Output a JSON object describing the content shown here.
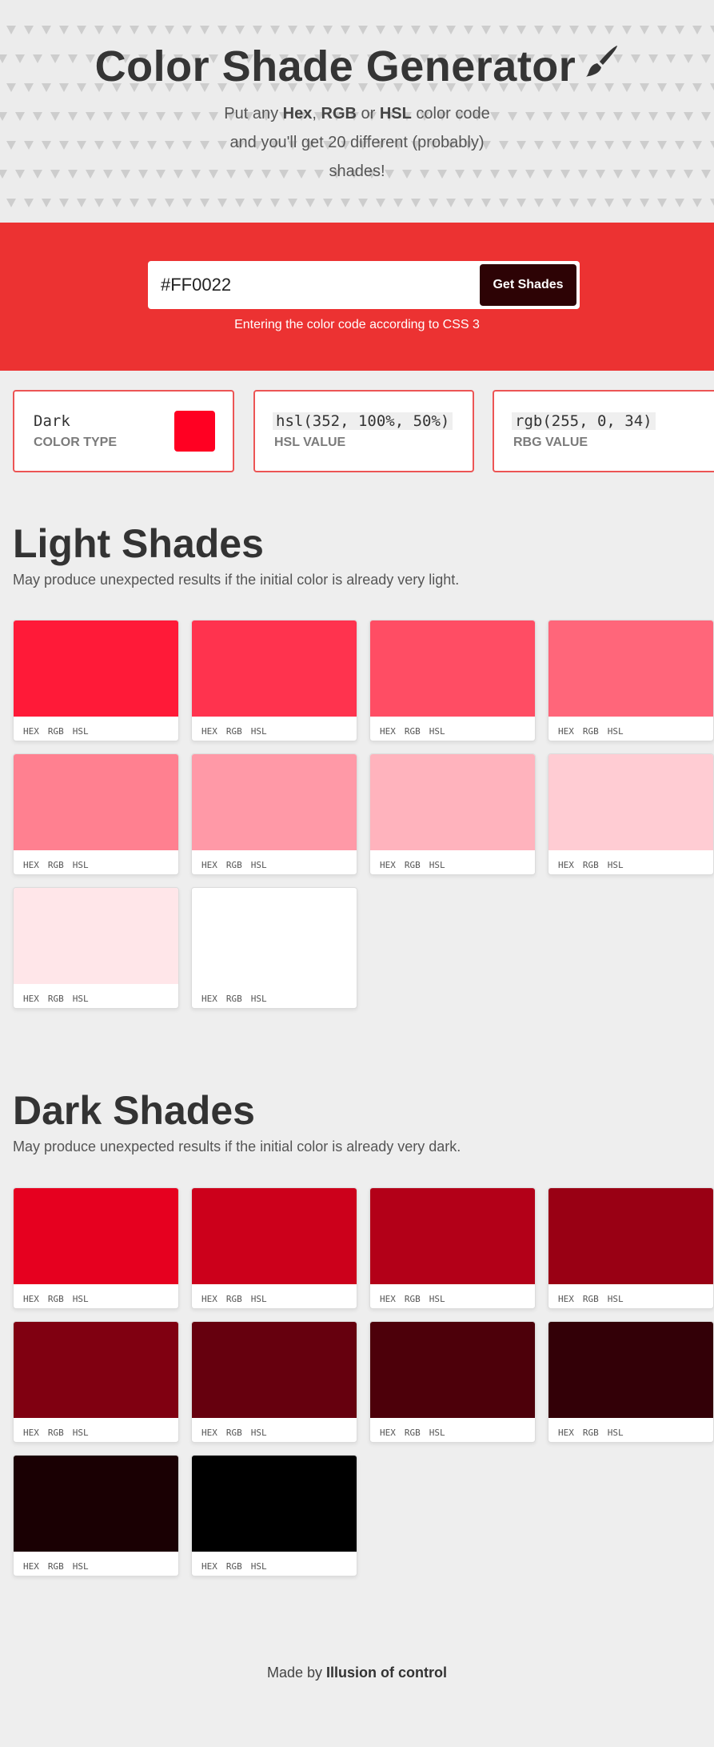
{
  "header": {
    "title": "Color Shade Generator",
    "brush_icon": "paintbrush-icon",
    "subtitle_prefix": "Put any ",
    "subtitle_hex": "Hex",
    "subtitle_sep1": ", ",
    "subtitle_rgb": "RGB",
    "subtitle_or": " or ",
    "subtitle_hsl": "HSL",
    "subtitle_rest": " color code and you'll get 20 different (probably) shades!"
  },
  "form": {
    "input_value": "#FF0022",
    "button_label": "Get Shades",
    "hint": "Entering the color code according to CSS 3"
  },
  "info": {
    "type_value": "Dark",
    "type_label": "COLOR TYPE",
    "swatch_color": "#FF0022",
    "hsl_value": "hsl(352, 100%, 50%)",
    "hsl_label": "HSL VALUE",
    "rgb_value": "rgb(255, 0, 34)",
    "rgb_label": "RBG VALUE"
  },
  "light": {
    "title": "Light Shades",
    "description": "May produce unexpected results if the initial color is already very light.",
    "shades": [
      "#FF1A38",
      "#FF334E",
      "#FF4D64",
      "#FF667A",
      "#FF8090",
      "#FF99A7",
      "#FFB3BD",
      "#FFCCD3",
      "#FFE6E9",
      "#FFFFFF"
    ]
  },
  "dark": {
    "title": "Dark Shades",
    "description": "May produce unexpected results if the initial color is already very dark.",
    "shades": [
      "#E6001F",
      "#CC001B",
      "#B30018",
      "#990014",
      "#800011",
      "#66000E",
      "#4D000A",
      "#330007",
      "#1A0003",
      "#000000"
    ]
  },
  "card_links": [
    "HEX",
    "RGB",
    "HSL"
  ],
  "footer": {
    "prefix": "Made by ",
    "author": "Illusion of control"
  },
  "colors": {
    "accent_red": "#EC3232",
    "button_dark": "#2D0305",
    "card_border": "#EC5555"
  }
}
